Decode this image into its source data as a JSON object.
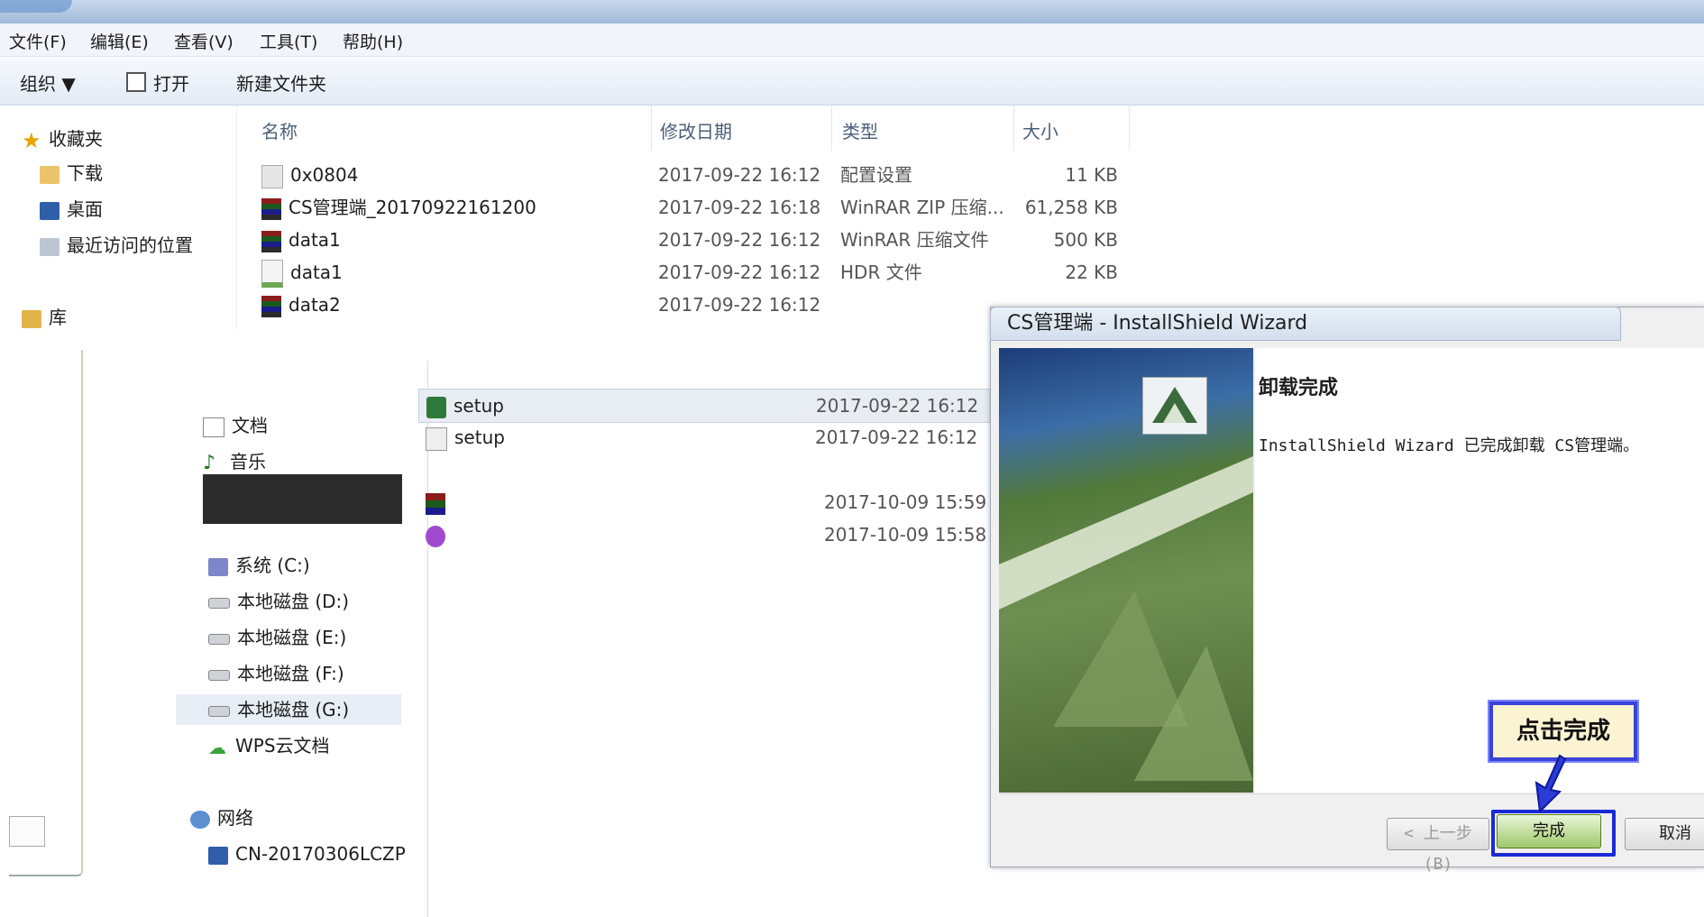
{
  "menubar": {
    "items": [
      "文件(F)",
      "编辑(E)",
      "查看(V)",
      "工具(T)",
      "帮助(H)"
    ]
  },
  "toolbar": {
    "organize": "组织 ▼",
    "open": "打开",
    "new_folder": "新建文件夹"
  },
  "nav": {
    "favorites": "收藏夹",
    "downloads": "下载",
    "desktop": "桌面",
    "recent": "最近访问的位置",
    "libraries": "库"
  },
  "columns": {
    "name": "名称",
    "date": "修改日期",
    "type": "类型",
    "size": "大小"
  },
  "files": [
    {
      "name": "0x0804",
      "date": "2017-09-22 16:12",
      "type": "配置设置",
      "size": "11 KB",
      "icon": "settings-file-icon"
    },
    {
      "name": "CS管理端_20170922161200",
      "date": "2017-09-22 16:18",
      "type": "WinRAR ZIP 压缩...",
      "size": "61,258 KB",
      "icon": "archive-icon"
    },
    {
      "name": "data1",
      "date": "2017-09-22 16:12",
      "type": "WinRAR 压缩文件",
      "size": "500 KB",
      "icon": "archive-icon"
    },
    {
      "name": "data1",
      "date": "2017-09-22 16:12",
      "type": "HDR 文件",
      "size": "22 KB",
      "icon": "hdr-file-icon"
    },
    {
      "name": "data2",
      "date": "2017-09-22 16:12",
      "type": "",
      "size": "",
      "icon": "archive-icon"
    }
  ],
  "nav2": {
    "documents": "文档",
    "music": "音乐",
    "drives": [
      "系统 (C:)",
      "本地磁盘 (D:)",
      "本地磁盘 (E:)",
      "本地磁盘 (F:)",
      "本地磁盘 (G:)"
    ],
    "wps": "WPS云文档",
    "network": "网络",
    "computer_name": "CN-20170306LCZP"
  },
  "files2": [
    {
      "name": "setup",
      "date": "2017-09-22 16:12",
      "selected": true
    },
    {
      "name": "setup",
      "date": "2017-09-22 16:12",
      "selected": false
    },
    {
      "name": "",
      "date": "2017-10-09 15:59",
      "selected": false
    },
    {
      "name": "",
      "date": "2017-10-09 15:58",
      "selected": false
    }
  ],
  "dialog": {
    "title": "CS管理端 - InstallShield Wizard",
    "heading": "卸载完成",
    "message": "InstallShield Wizard 已完成卸载 CS管理端。",
    "back_button": "< 上一步 (B)",
    "finish_button": "完成",
    "cancel_button": "取消"
  },
  "annotation": {
    "callout": "点击完成"
  }
}
